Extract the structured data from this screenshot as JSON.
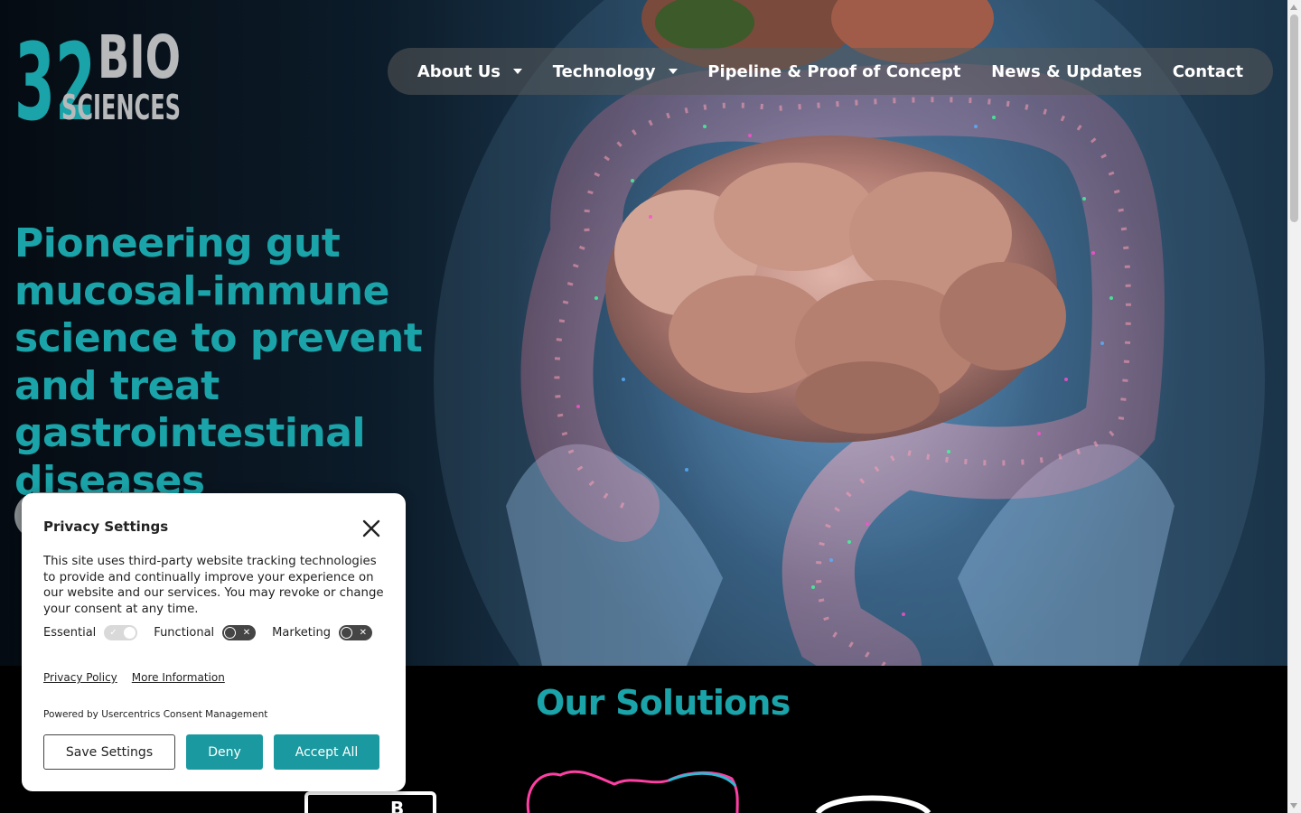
{
  "logo": {
    "line1_num": "32",
    "line1_word": "BIO",
    "line2": "SCIENCES"
  },
  "nav": {
    "items": [
      {
        "label": "About Us",
        "has_dropdown": true
      },
      {
        "label": "Technology",
        "has_dropdown": true
      },
      {
        "label": "Pipeline & Proof of Concept",
        "has_dropdown": false
      },
      {
        "label": "News & Updates",
        "has_dropdown": false
      },
      {
        "label": "Contact",
        "has_dropdown": false
      }
    ]
  },
  "hero": {
    "headline": "Pioneering gut mucosal-immune science to prevent and treat gastrointestinal diseases"
  },
  "solutions": {
    "title": "Our Solutions"
  },
  "consent": {
    "title": "Privacy Settings",
    "close_icon": "close-icon",
    "body": "This site uses third-party website tracking technologies to provide and continually improve your experience on our website and our services. You may revoke or change your consent at any time.",
    "toggles": [
      {
        "label": "Essential",
        "state": "on-disabled"
      },
      {
        "label": "Functional",
        "state": "off"
      },
      {
        "label": "Marketing",
        "state": "off"
      }
    ],
    "links": {
      "privacy_policy": "Privacy Policy",
      "more_info": "More Information"
    },
    "powered_by": "Powered by Usercentrics Consent Management",
    "buttons": {
      "save": "Save Settings",
      "deny": "Deny",
      "accept": "Accept All"
    }
  },
  "colors": {
    "brand_teal": "#1aa3a8",
    "button_teal": "#1a9aa0",
    "logo_gray": "#b7b9bb",
    "nav_bg": "rgba(90,90,90,0.55)"
  }
}
